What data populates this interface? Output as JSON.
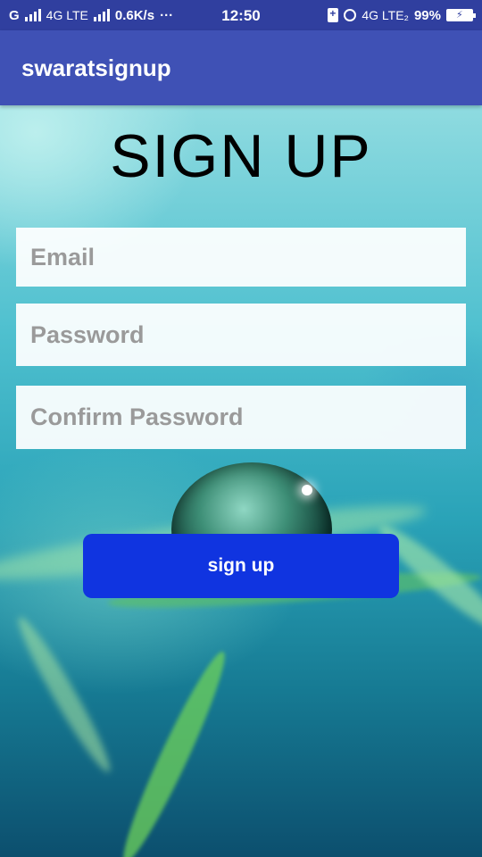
{
  "status_bar": {
    "carrier_g": "G",
    "network_1": "4G LTE",
    "speed": "0.6K/s",
    "dots": "···",
    "time": "12:50",
    "network_2": "4G LTE₂",
    "battery_percent": "99%",
    "icons": [
      "signal-icon",
      "signal-icon",
      "battery-saver-icon",
      "alarm-icon",
      "battery-icon"
    ]
  },
  "app_bar": {
    "title": "swaratsignup"
  },
  "form": {
    "heading": "SIGN UP",
    "email_placeholder": "Email",
    "password_placeholder": "Password",
    "confirm_placeholder": "Confirm Password",
    "submit_label": "sign up"
  },
  "colors": {
    "status_bar": "#303f9f",
    "app_bar": "#3f51b5",
    "button": "#1034e0"
  }
}
